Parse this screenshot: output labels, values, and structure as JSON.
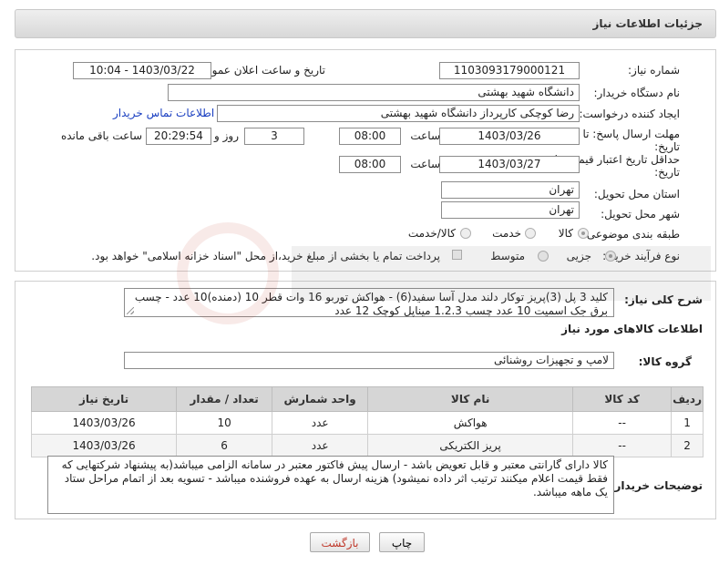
{
  "header": {
    "title": "جزئیات اطلاعات نیاز"
  },
  "form": {
    "need_number": {
      "label": "شماره نیاز:",
      "value": "1103093179000121"
    },
    "announce": {
      "label": "تاریخ و ساعت اعلان عمومی:",
      "value": "1403/03/22 - 10:04"
    },
    "buyer_org": {
      "label": "نام دستگاه خریدار:",
      "value": "دانشگاه شهید بهشتی"
    },
    "requester": {
      "label": "ایجاد کننده درخواست:",
      "value": "رضا کوچکی کارپرداز دانشگاه شهید بهشتی",
      "contact_link": "اطلاعات تماس خریدار"
    },
    "reply_deadline": {
      "label_line1": "مهلت ارسال پاسخ: تا",
      "label_line2": "تاریخ:",
      "date": "1403/03/26",
      "time_label": "ساعت",
      "time": "08:00",
      "days": "3",
      "days_label": "روز و",
      "remaining": "20:29:54",
      "remaining_label": "ساعت باقی مانده"
    },
    "price_validity": {
      "label_line1": "حداقل تاریخ اعتبار قیمت: تا",
      "label_line2": "تاریخ:",
      "date": "1403/03/27",
      "time_label": "ساعت",
      "time": "08:00"
    },
    "province": {
      "label": "استان محل تحویل:",
      "value": "تهران"
    },
    "city": {
      "label": "شهر محل تحویل:",
      "value": "تهران"
    },
    "category": {
      "label": "طبقه بندی موضوعی:",
      "options": [
        "کالا",
        "خدمت",
        "کالا/خدمت"
      ],
      "selected": "کالا"
    },
    "process": {
      "label": "نوع فرآیند خرید :",
      "options": [
        "جزیی",
        "متوسط"
      ],
      "note": "پرداخت تمام یا بخشی از مبلغ خرید،از محل \"اسناد خزانه اسلامی\" خواهد بود."
    }
  },
  "summary": {
    "label": "شرح کلی نیاز:",
    "text": "کلید 3 پل (3)پریز توکار دلند مدل آسا سفید(6)  - هواکش توربو 16 وات قطر 10 (دمنده)10 عدد - چسب برق جک اسمیت 10 عدد چسب 1.2.3 میناپل کوچک 12 عدد"
  },
  "goods": {
    "section_title": "اطلاعات کالاهای مورد نیاز",
    "group_label": "گروه کالا:",
    "group_value": "لامپ و تجهیزات روشنائی",
    "columns": [
      "ردیف",
      "کد کالا",
      "نام کالا",
      "واحد شمارش",
      "تعداد / مقدار",
      "تاریخ نیاز"
    ],
    "rows": [
      [
        "1",
        "--",
        "هواکش",
        "عدد",
        "10",
        "1403/03/26"
      ],
      [
        "2",
        "--",
        "پریز الکتریکی",
        "عدد",
        "6",
        "1403/03/26"
      ]
    ]
  },
  "buyer_notes": {
    "label": "توضیحات خریدار:",
    "text": "کالا دارای گارانتی معتبر و قابل تعویض باشد - ارسال پیش فاکتور معتبر در سامانه الزامی میباشد(به پیشنهاد شرکتهایی که فقط قیمت اعلام میکنند ترتیب اثر داده نمیشود) هزینه ارسال به عهده فروشنده میباشد - تسویه بعد از اتمام مراحل ستاد یک ماهه میباشد."
  },
  "buttons": {
    "print": "چاپ",
    "back": "بازگشت"
  },
  "colors": {
    "link": "#1a3fc1",
    "back_text": "#c0392b",
    "header_bg": "#dedede"
  }
}
